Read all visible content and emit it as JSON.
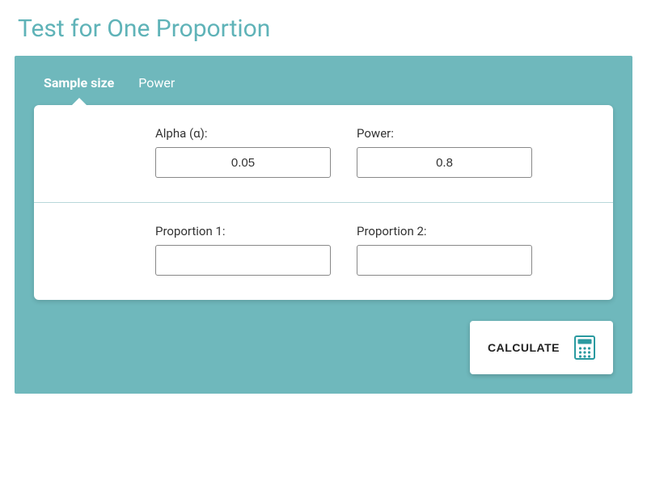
{
  "title": "Test for One Proportion",
  "tabs": [
    {
      "label": "Sample size",
      "active": true
    },
    {
      "label": "Power",
      "active": false
    }
  ],
  "fields": {
    "alpha": {
      "label": "Alpha (α):",
      "value": "0.05"
    },
    "power": {
      "label": "Power:",
      "value": "0.8"
    },
    "proportion1": {
      "label": "Proportion 1:",
      "value": ""
    },
    "proportion2": {
      "label": "Proportion 2:",
      "value": ""
    }
  },
  "calculate_label": "CALCULATE",
  "colors": {
    "accent": "#5fb3b8",
    "panel": "#6fb8bc"
  }
}
